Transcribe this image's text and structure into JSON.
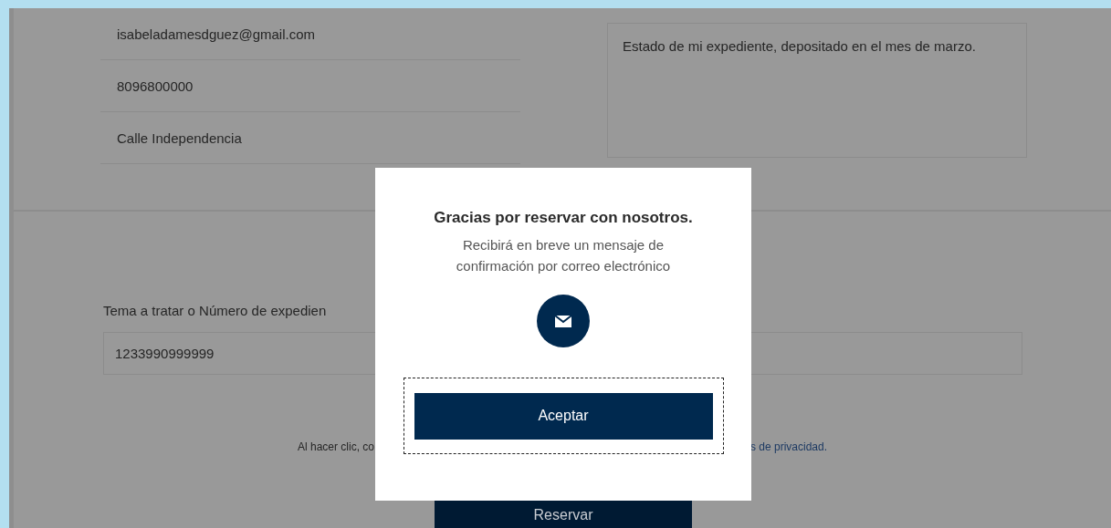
{
  "contact_fields": [
    {
      "value": "isabeladamesdguez@gmail.com"
    },
    {
      "value": "8096800000"
    },
    {
      "value": "Calle Independencia"
    }
  ],
  "message_field": {
    "value": "Estado de mi expediente, depositado en el mes de marzo."
  },
  "subject": {
    "label": "Tema a tratar o Número de expedien",
    "value": "1233990999999"
  },
  "consent": {
    "text_start": "Al hacer clic, co",
    "link_end": "s de privacidad."
  },
  "reserve_button": "Reservar",
  "dialog": {
    "title": "Gracias por reservar con nosotros.",
    "message": "Recibirá en breve un mensaje de confirmación por correo electrónico",
    "button": "Aceptar",
    "button_focused": true
  }
}
